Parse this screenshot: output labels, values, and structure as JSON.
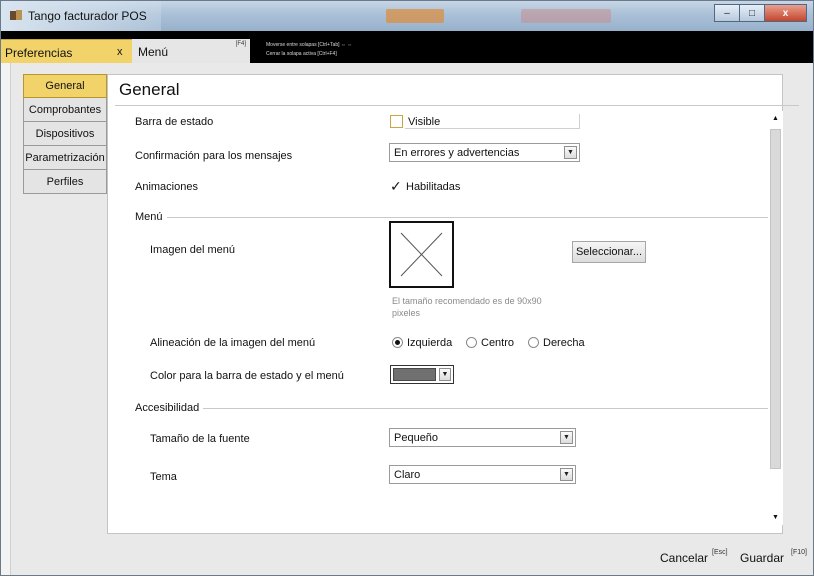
{
  "window": {
    "title": "Tango facturador POS",
    "minimize_glyph": "–",
    "maximize_glyph": "□",
    "close_glyph": "x"
  },
  "tabs": {
    "active": {
      "label": "Preferencias",
      "close": "x"
    },
    "other": {
      "label": "Menú",
      "shortcut": "[F4]"
    },
    "hint_line1": "Moverse entre solapas [Ctrl+Tab] ⇔ ⇔",
    "hint_line2": "Cerrar la solapa activa [Ctrl+F4]"
  },
  "nav": {
    "items": [
      {
        "label": "General",
        "active": true
      },
      {
        "label": "Comprobantes",
        "active": false
      },
      {
        "label": "Dispositivos",
        "active": false
      },
      {
        "label": "Parametrización",
        "active": false
      },
      {
        "label": "Perfiles",
        "active": false
      }
    ]
  },
  "panel": {
    "title": "General",
    "status_bar": {
      "label": "Barra de estado",
      "checkbox_label": "Visible",
      "checked": false
    },
    "confirmation": {
      "label": "Confirmación para los mensajes",
      "value": "En errores y advertencias"
    },
    "animations": {
      "label": "Animaciones",
      "checkbox_label": "Habilitadas",
      "checked": true,
      "check_glyph": "✓"
    },
    "menu_section": {
      "label": "Menú",
      "image_label": "Imagen del menú",
      "select_button": "Seleccionar...",
      "size_hint_line1": "El tamaño recomendado es de 90x90",
      "size_hint_line2": "pixeles",
      "alignment": {
        "label": "Alineación de la imagen del menú",
        "options": [
          "Izquierda",
          "Centro",
          "Derecha"
        ],
        "selected": "Izquierda"
      },
      "color": {
        "label": "Color para la barra de estado y el menú",
        "value": "#707070"
      }
    },
    "accessibility_section": {
      "label": "Accesibilidad",
      "font_size": {
        "label": "Tamaño de la fuente",
        "value": "Pequeño"
      },
      "theme": {
        "label": "Tema",
        "value": "Claro"
      }
    },
    "scroll_up": "▲",
    "scroll_down": "▼",
    "dropdown_arrow": "▼"
  },
  "footer": {
    "cancel": {
      "label": "Cancelar",
      "shortcut": "[Esc]"
    },
    "save": {
      "label": "Guardar",
      "shortcut": "[F10]"
    }
  },
  "colors": {
    "accent": "#f1d36a",
    "tabbar": "#000000",
    "swatch": "#707070"
  }
}
